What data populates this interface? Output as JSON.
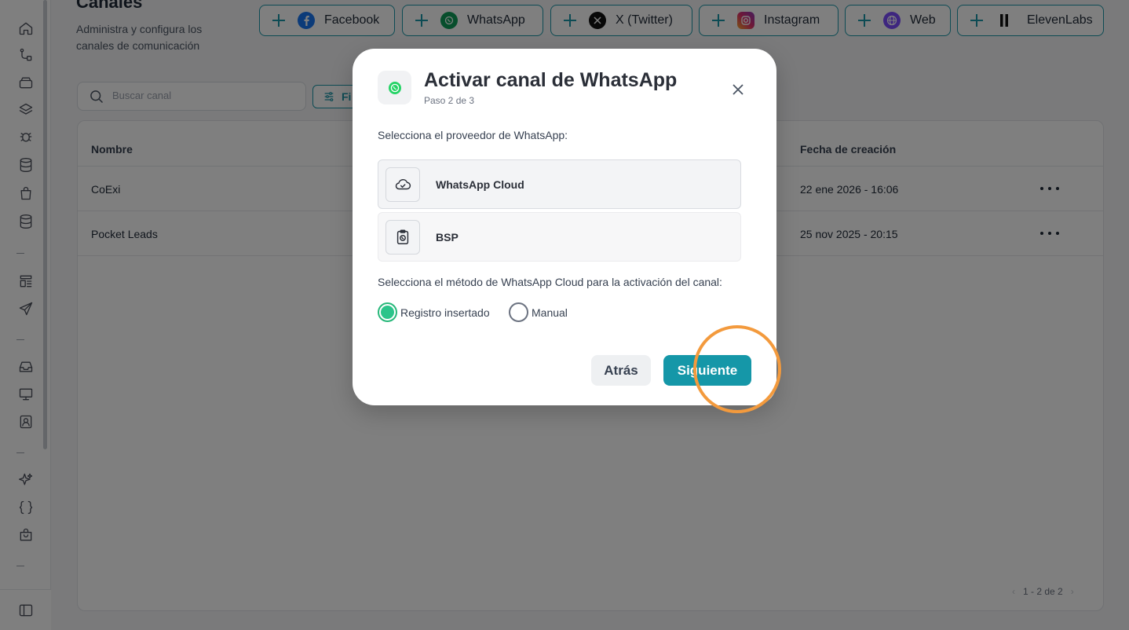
{
  "header": {
    "title": "Canales",
    "subtitle": "Administra y configura los canales de comunicación"
  },
  "channel_buttons": [
    {
      "label": "Facebook",
      "icon": "facebook-icon",
      "color": "#1877f2"
    },
    {
      "label": "WhatsApp",
      "icon": "whatsapp-icon",
      "color": "#25d366"
    },
    {
      "label": "X (Twitter)",
      "icon": "x-twitter-icon",
      "color": "#000000"
    },
    {
      "label": "Instagram",
      "icon": "instagram-icon",
      "color": "#e1306c"
    },
    {
      "label": "Web",
      "icon": "globe-icon",
      "color": "#7c4dff"
    },
    {
      "label": "ElevenLabs",
      "icon": "elevenlabs-icon",
      "color": "#000000"
    }
  ],
  "toolbar": {
    "search_placeholder": "Buscar canal",
    "filter_label": "Fi"
  },
  "table": {
    "columns": {
      "name": "Nombre",
      "created": "Fecha de creación"
    },
    "rows": [
      {
        "name": "CoExi",
        "created": "22 ene 2026 - 16:06"
      },
      {
        "name": "Pocket Leads",
        "created": "25 nov 2025 - 20:15"
      }
    ],
    "pagination": "1 - 2 de 2"
  },
  "modal": {
    "title": "Activar canal de WhatsApp",
    "step": "Paso 2 de 3",
    "provider_prompt": "Selecciona el proveedor de WhatsApp:",
    "providers": [
      {
        "label": "WhatsApp Cloud",
        "icon": "cloud-check-icon",
        "selected": true
      },
      {
        "label": "BSP",
        "icon": "clipboard-whatsapp-icon",
        "selected": false
      }
    ],
    "method_prompt": "Selecciona el método de WhatsApp Cloud para la activación del canal:",
    "methods": [
      {
        "label": "Registro insertado",
        "selected": true
      },
      {
        "label": "Manual",
        "selected": false
      }
    ],
    "back_label": "Atrás",
    "next_label": "Siguiente"
  },
  "colors": {
    "accent": "#1597a8",
    "radio_selected": "#2bc48a",
    "highlight_ring": "#f39a3d"
  }
}
